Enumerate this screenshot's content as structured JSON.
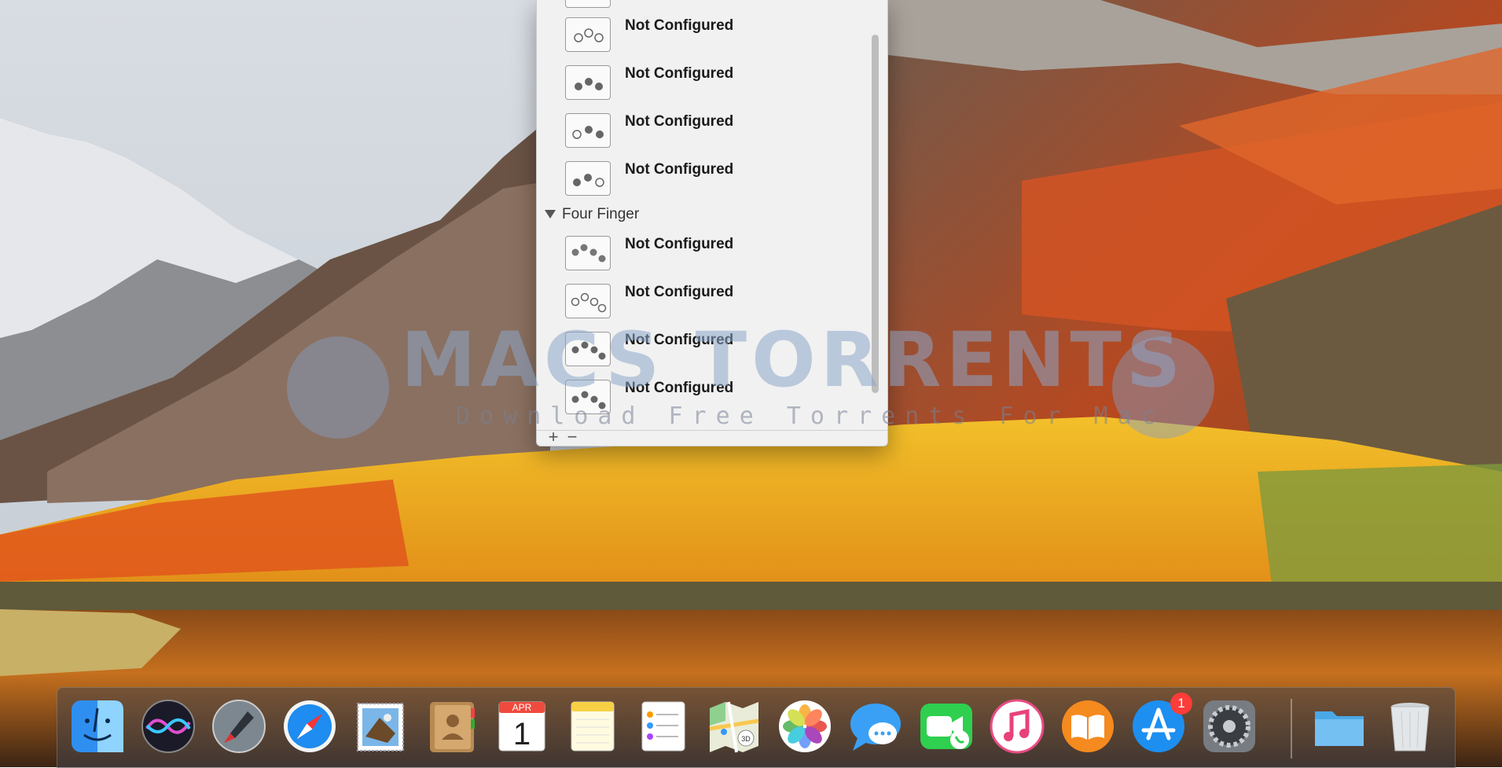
{
  "gesture_panel": {
    "rows_top": [
      {
        "label": "Not Configured"
      },
      {
        "label": "Not Configured"
      },
      {
        "label": "Not Configured"
      },
      {
        "label": "Not Configured"
      }
    ],
    "section_title": "Four Finger",
    "rows_four_finger": [
      {
        "label": "Not Configured"
      },
      {
        "label": "Not Configured"
      },
      {
        "label": "Not Configured"
      },
      {
        "label": "Not Configured"
      }
    ],
    "add_label": "+",
    "remove_label": "−"
  },
  "watermark": {
    "title": "MACS TORRENTS",
    "subtitle": "Download Free Torrents For Mac"
  },
  "dock": {
    "items": [
      {
        "icon": "finder-icon"
      },
      {
        "icon": "siri-icon"
      },
      {
        "icon": "launchpad-icon"
      },
      {
        "icon": "safari-icon"
      },
      {
        "icon": "mail-icon"
      },
      {
        "icon": "contacts-icon"
      },
      {
        "icon": "calendar-icon",
        "month": "APR",
        "day": "1"
      },
      {
        "icon": "notes-icon"
      },
      {
        "icon": "reminders-icon"
      },
      {
        "icon": "maps-icon"
      },
      {
        "icon": "photos-icon"
      },
      {
        "icon": "messages-icon"
      },
      {
        "icon": "facetime-icon"
      },
      {
        "icon": "itunes-icon"
      },
      {
        "icon": "ibooks-icon"
      },
      {
        "icon": "app-store-icon",
        "badge": "1"
      },
      {
        "icon": "system-preferences-icon"
      },
      {
        "icon": "downloads-folder-icon"
      },
      {
        "icon": "trash-icon"
      }
    ]
  },
  "colors": {
    "badge": "#fc3d39",
    "panel_bg": "#f1f1f1"
  }
}
